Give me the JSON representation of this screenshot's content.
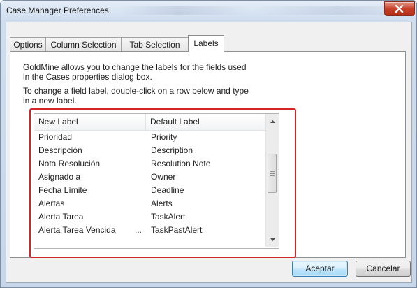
{
  "window": {
    "title": "Case Manager Preferences",
    "close_icon": "close-icon"
  },
  "tabs": [
    {
      "label": "Options",
      "active": false
    },
    {
      "label": "Column Selection",
      "active": false
    },
    {
      "label": "Tab Selection",
      "active": false
    },
    {
      "label": "Labels",
      "active": true
    }
  ],
  "labels_panel": {
    "description_line1": "GoldMine allows you to change the labels for the fields used",
    "description_line2": "in the Cases properties dialog box.",
    "instruction_line1": "To change a field label, double-click on a row below and type",
    "instruction_line2": "in a new label.",
    "highlight_color": "#d3262b",
    "list": {
      "columns": [
        "New Label",
        "Default Label"
      ],
      "rows": [
        {
          "new_label": "Prioridad",
          "default_label": "Priority",
          "truncated": false
        },
        {
          "new_label": "Descripción",
          "default_label": "Description",
          "truncated": false
        },
        {
          "new_label": "Nota Resolución",
          "default_label": "Resolution Note",
          "truncated": false
        },
        {
          "new_label": "Asignado a",
          "default_label": "Owner",
          "truncated": false
        },
        {
          "new_label": "Fecha Límite",
          "default_label": "Deadline",
          "truncated": false
        },
        {
          "new_label": "Alertas",
          "default_label": "Alerts",
          "truncated": false
        },
        {
          "new_label": "Alerta Tarea",
          "default_label": "TaskAlert",
          "truncated": false
        },
        {
          "new_label": "Alerta Tarea Vencida",
          "ellipsis": "...",
          "default_label": "TaskPastAlert",
          "truncated": true
        }
      ]
    }
  },
  "buttons": {
    "ok": "Aceptar",
    "cancel": "Cancelar"
  }
}
